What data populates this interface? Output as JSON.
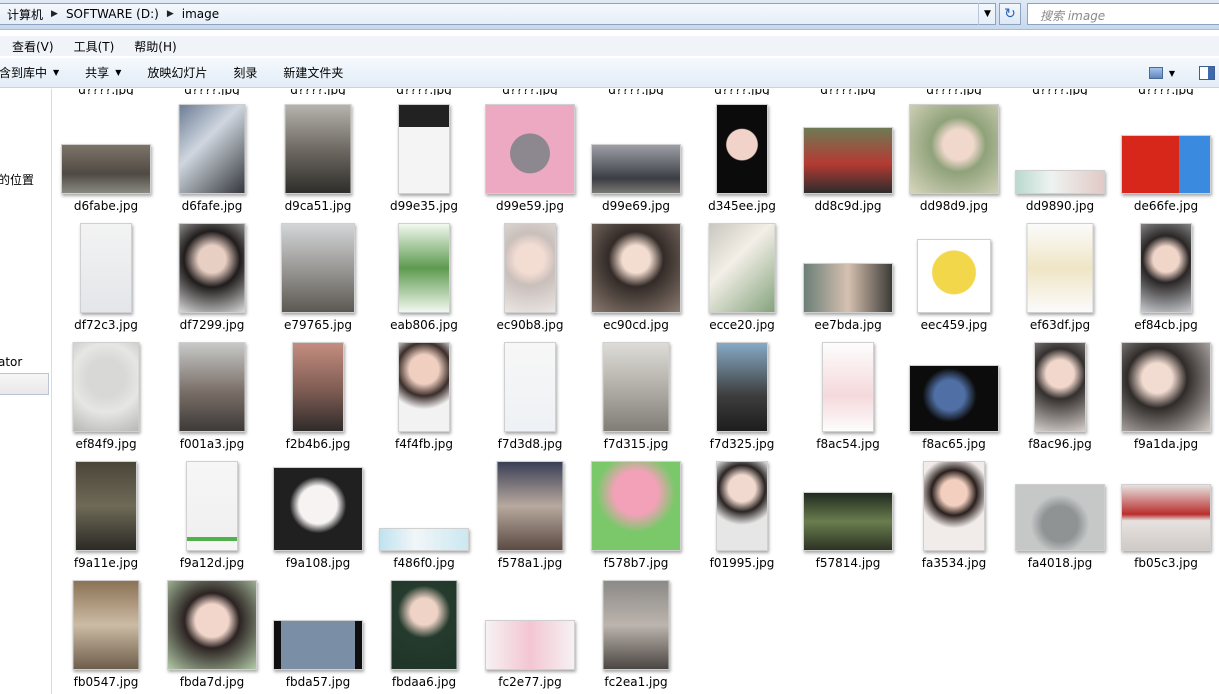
{
  "address": {
    "crumbs": [
      "计算机",
      "SOFTWARE (D:)",
      "image"
    ],
    "search_placeholder": "搜索 image"
  },
  "menu": [
    "查看(V)",
    "工具(T)",
    "帮助(H)"
  ],
  "toolbar": {
    "library": "含到库中",
    "share": "共享",
    "slideshow": "放映幻灯片",
    "burn": "刻录",
    "new_folder": "新建文件夹"
  },
  "nav": {
    "item1": "的位置",
    "item2": "ator"
  },
  "top_row_cut": [
    "d????.jpg",
    "d????.jpg",
    "d????.jpg",
    "d????.jpg",
    "d????.jpg",
    "d????.jpg",
    "d????.jpg",
    "d????.jpg",
    "d????.jpg",
    "d????.jpg",
    "d????.jpg"
  ],
  "rows": [
    [
      {
        "name": "d6fabe.jpg",
        "w": 90,
        "h": 50,
        "bg": "linear-gradient(#7d7468,#4f4a44 60%,#8a8a80)"
      },
      {
        "name": "d6fafe.jpg",
        "w": 67,
        "h": 90,
        "bg": "linear-gradient(135deg,#6e7e96,#cfd6df 40%,#34373c)"
      },
      {
        "name": "d9ca51.jpg",
        "w": 67,
        "h": 90,
        "bg": "linear-gradient(#b5b3ad,#6e6a63 50%,#2f2d2a)"
      },
      {
        "name": "d99e35.jpg",
        "w": 52,
        "h": 90,
        "bg": "linear-gradient(#222 0 25%,#f4f4f4 25% 100%)"
      },
      {
        "name": "d99e59.jpg",
        "w": 90,
        "h": 90,
        "bg": "radial-gradient(circle at 50% 55%,#8d8790 0 30%,#eda9c1 31%)"
      },
      {
        "name": "d99e69.jpg",
        "w": 90,
        "h": 50,
        "bg": "linear-gradient(#9e9fa6,#3b3d45 70%,#7b7873)"
      },
      {
        "name": "d345ee.jpg",
        "w": 52,
        "h": 90,
        "bg": "radial-gradient(circle at 50% 45%,#f1d3c9 0 28%,#0b0b0b 30%)"
      },
      {
        "name": "dd8c9d.jpg",
        "w": 90,
        "h": 67,
        "bg": "linear-gradient(#6e7a56,#b53a32 55%,#2c2c2c)"
      },
      {
        "name": "dd98d9.jpg",
        "w": 90,
        "h": 90,
        "bg": "radial-gradient(circle at 55% 45%,#f0d8cc 0 22%,#8fa27a 40%,#d9d6bf)"
      },
      {
        "name": "dd9890.jpg",
        "w": 90,
        "h": 24,
        "bg": "linear-gradient(90deg,#b9d9cf,#eef3f0 40%,#e1c9c6)"
      },
      {
        "name": "de66fe.jpg",
        "w": 90,
        "h": 59,
        "bg": "linear-gradient(90deg,#d7261a 0 65%,#3a8be0 65%)"
      }
    ],
    [
      {
        "name": "df72c3.jpg",
        "w": 52,
        "h": 90,
        "bg": "linear-gradient(#f3f3f3,#e3e6ea)"
      },
      {
        "name": "df7299.jpg",
        "w": 67,
        "h": 90,
        "bg": "radial-gradient(circle at 50% 40%,#e8cfc3 0 22%,#201c1c 45%,#dadada)"
      },
      {
        "name": "e79765.jpg",
        "w": 74,
        "h": 90,
        "bg": "linear-gradient(#d3d5d7,#8f8d89 60%,#5b5852)"
      },
      {
        "name": "eab806.jpg",
        "w": 52,
        "h": 90,
        "bg": "linear-gradient(#f1f8ef,#5d9a4f 50%,#f1f8ef)"
      },
      {
        "name": "ec90b8.jpg",
        "w": 52,
        "h": 90,
        "bg": "radial-gradient(circle at 50% 40%,#f3dcd2 0 25%,#c9bfbb 45%,#eae6e3)"
      },
      {
        "name": "ec90cd.jpg",
        "w": 90,
        "h": 90,
        "bg": "radial-gradient(circle at 50% 40%,#f3dcd0 0 20%,#332b27 40%,#8a7a70)"
      },
      {
        "name": "ecce20.jpg",
        "w": 67,
        "h": 90,
        "bg": "linear-gradient(135deg,#c9c7bf,#f3efe7 40%,#84a37d)"
      },
      {
        "name": "ee7bda.jpg",
        "w": 90,
        "h": 50,
        "bg": "linear-gradient(90deg,#6b7f77,#d6c1b0 50%,#3c3b37)"
      },
      {
        "name": "eec459.jpg",
        "w": 74,
        "h": 74,
        "bg": "radial-gradient(circle at 50% 45%,#f3d74b 0 40%,#fff 42%)"
      },
      {
        "name": "ef63df.jpg",
        "w": 67,
        "h": 90,
        "bg": "linear-gradient(#fbfbfb,#efe5c5 50%,#fbfbfb)"
      },
      {
        "name": "ef84cb.jpg",
        "w": 52,
        "h": 90,
        "bg": "radial-gradient(circle at 50% 40%,#f0d5c9 0 22%,#2a2626 40%,#c9ccd0)"
      }
    ],
    [
      {
        "name": "ef84f9.jpg",
        "w": 67,
        "h": 90,
        "bg": "radial-gradient(circle at 50% 40%,#d8d8d6 0 30%,#e6e6e4 55%,#b7b7b5)"
      },
      {
        "name": "f001a3.jpg",
        "w": 67,
        "h": 90,
        "bg": "linear-gradient(#c7c9c8,#7a6f68 55%,#3d3a38)"
      },
      {
        "name": "f2b4b6.jpg",
        "w": 52,
        "h": 90,
        "bg": "linear-gradient(#c58d80,#7d5b52 55%,#2f2b2b)"
      },
      {
        "name": "f4f4fb.jpg",
        "w": 52,
        "h": 90,
        "bg": "radial-gradient(circle at 50% 30%,#f0cfc0 0 22%,#3a2d2a 40%,#f2f2f2 60%)"
      },
      {
        "name": "f7d3d8.jpg",
        "w": 52,
        "h": 90,
        "bg": "linear-gradient(#f7f7f7,#eef1f5)"
      },
      {
        "name": "f7d315.jpg",
        "w": 67,
        "h": 90,
        "bg": "linear-gradient(#dedcd6,#a9a69f 60%,#807d77)"
      },
      {
        "name": "f7d325.jpg",
        "w": 52,
        "h": 90,
        "bg": "linear-gradient(#87aac6,#3d3d3d 60%,#1d1d1d)"
      },
      {
        "name": "f8ac54.jpg",
        "w": 52,
        "h": 90,
        "bg": "linear-gradient(#fdfdfd,#f5d9dc 60%,#fdfdfd)"
      },
      {
        "name": "f8ac65.jpg",
        "w": 90,
        "h": 67,
        "bg": "radial-gradient(circle at 45% 45%,#4f6fa5 0 25%,#0c0c0c 45%)"
      },
      {
        "name": "f8ac96.jpg",
        "w": 52,
        "h": 90,
        "bg": "radial-gradient(circle at 50% 35%,#f2d8cc 0 22%,#34302f 40%,#d6cfcb)"
      },
      {
        "name": "f9a1da.jpg",
        "w": 90,
        "h": 90,
        "bg": "radial-gradient(circle at 40% 40%,#f2dbd0 0 20%,#2f2b29 40%,#d1cbc7)"
      }
    ],
    [
      {
        "name": "f9a11e.jpg",
        "w": 62,
        "h": 90,
        "bg": "linear-gradient(#4a4538,#6f6a57 50%,#2b2a25)"
      },
      {
        "name": "f9a12d.jpg",
        "w": 52,
        "h": 90,
        "bg": "linear-gradient(#f6f6f6,#f0f0f0 85%,#4fb14a 85% 90%,#f6f6f6 90%)"
      },
      {
        "name": "f9a108.jpg",
        "w": 90,
        "h": 84,
        "bg": "radial-gradient(circle at 50% 45%,#f7f3f3 0 30%,#202020 45%)"
      },
      {
        "name": "f486f0.jpg",
        "w": 90,
        "h": 23,
        "bg": "linear-gradient(90deg,#bfe3f0,#f1f6f8 40%,#cbe8f1)"
      },
      {
        "name": "f578a1.jpg",
        "w": 67,
        "h": 90,
        "bg": "linear-gradient(#3a3f56,#b8a99e 50%,#5a4a43)"
      },
      {
        "name": "f578b7.jpg",
        "w": 90,
        "h": 90,
        "bg": "radial-gradient(circle at 50% 35%,#f3a1b8 0 30%,#7ac86a 55%)"
      },
      {
        "name": "f01995.jpg",
        "w": 52,
        "h": 90,
        "bg": "radial-gradient(circle at 50% 30%,#f2d9cf 0 20%,#2a2523 35%,#e6e6e6 55%)"
      },
      {
        "name": "f57814.jpg",
        "w": 90,
        "h": 59,
        "bg": "linear-gradient(#1f2b1e,#6a7d4f 50%,#2c3324)"
      },
      {
        "name": "fa3534.jpg",
        "w": 62,
        "h": 90,
        "bg": "radial-gradient(circle at 50% 35%,#f2cfbf 0 20%,#2a1f1c 35%,#f1ecea 55%)"
      },
      {
        "name": "fa4018.jpg",
        "w": 90,
        "h": 67,
        "bg": "radial-gradient(circle at 50% 60%,#8f9394 0 30%,#c6c8c8 50%)"
      },
      {
        "name": "fb05c3.jpg",
        "w": 90,
        "h": 67,
        "bg": "linear-gradient(#e6e2df,#b92e2e 45%,#e6e2df 55%,#cfcac6)"
      }
    ],
    [
      {
        "name": "fb0547.jpg",
        "w": 67,
        "h": 90,
        "bg": "linear-gradient(#8b7255,#ccbba4 50%,#6d5d4b)"
      },
      {
        "name": "fbda7d.jpg",
        "w": 90,
        "h": 90,
        "bg": "radial-gradient(circle at 50% 45%,#f2d6cb 0 25%,#2c2322 42%,#b3cba9)"
      },
      {
        "name": "fbda57.jpg",
        "w": 90,
        "h": 50,
        "bg": "linear-gradient(90deg,#0f0f0f 0 8%,#7a8fa5 8% 92%,#0f0f0f 92%)"
      },
      {
        "name": "fbdaa6.jpg",
        "w": 67,
        "h": 90,
        "bg": "radial-gradient(circle at 50% 35%,#f0d3c7 0 20%,#243b2d 40%,#1e3427)"
      },
      {
        "name": "fc2e77.jpg",
        "w": 90,
        "h": 50,
        "bg": "linear-gradient(90deg,#f6f1f3,#f3c6d2 50%,#f6f1f3)"
      },
      {
        "name": "fc2ea1.jpg",
        "w": 67,
        "h": 90,
        "bg": "linear-gradient(#8b8a87,#bcb4ad 50%,#4b4643)"
      }
    ]
  ]
}
